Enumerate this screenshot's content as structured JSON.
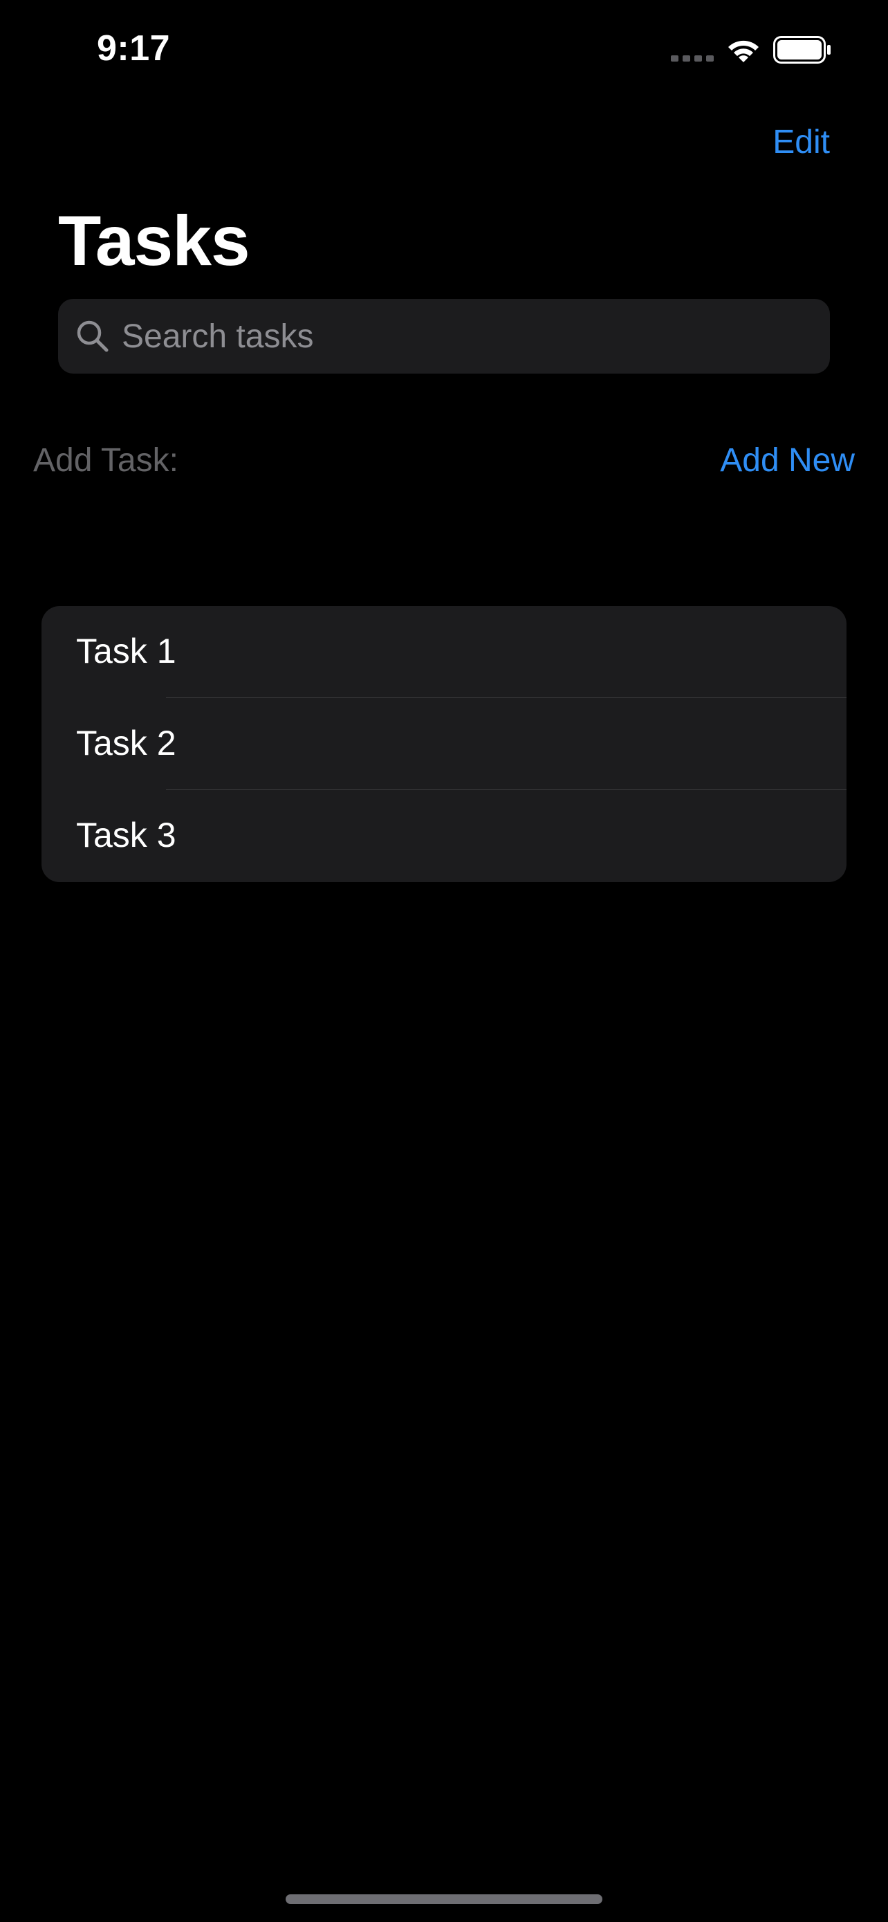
{
  "status_bar": {
    "time": "9:17"
  },
  "nav": {
    "edit_label": "Edit",
    "title": "Tasks"
  },
  "search": {
    "placeholder": "Search tasks",
    "value": ""
  },
  "add_task": {
    "label": "Add Task:",
    "button_label": "Add New"
  },
  "tasks": [
    {
      "label": "Task 1"
    },
    {
      "label": "Task 2"
    },
    {
      "label": "Task 3"
    }
  ],
  "icons": {
    "search": "search-icon",
    "wifi": "wifi-icon",
    "battery": "battery-icon",
    "signal": "cellular-signal-icon"
  },
  "colors": {
    "background": "#000000",
    "accent": "#2f8ef5",
    "card": "#1c1c1e",
    "secondary_text": "#636366",
    "placeholder": "#8e8e93"
  }
}
